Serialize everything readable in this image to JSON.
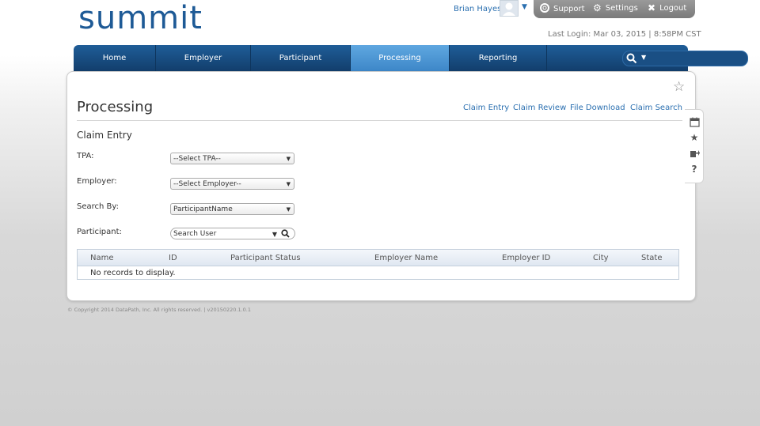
{
  "header": {
    "logo_text": "summit",
    "user_name": "Brian Hayes",
    "support_label": "Support",
    "settings_label": "Settings",
    "logout_label": "Logout",
    "last_login": "Last Login: Mar 03, 2015 | 8:58PM CST"
  },
  "nav": {
    "items": [
      {
        "label": "Home"
      },
      {
        "label": "Employer"
      },
      {
        "label": "Participant"
      },
      {
        "label": "Processing",
        "active": true
      },
      {
        "label": "Reporting"
      }
    ],
    "search_value": ""
  },
  "page": {
    "title": "Processing",
    "sublinks": [
      "Claim Entry",
      "Claim Review",
      "File Download",
      "Claim Search"
    ],
    "section_title": "Claim Entry"
  },
  "form": {
    "tpa_label": "TPA:",
    "tpa_value": "--Select TPA--",
    "employer_label": "Employer:",
    "employer_value": "--Select Employer--",
    "searchby_label": "Search By:",
    "searchby_value": "ParticipantName",
    "participant_label": "Participant:",
    "participant_placeholder": "Search User"
  },
  "grid": {
    "columns": [
      "Name",
      "ID",
      "Participant Status",
      "Employer Name",
      "Employer ID",
      "City",
      "State"
    ],
    "empty_message": "No records to display."
  },
  "footer": {
    "copyright": "© Copyright 2014 DataPath, Inc. All rights reserved. | v20150220.1.0.1"
  },
  "icons": {
    "user_menu": "chevron-down-icon",
    "support": "life-ring-icon",
    "settings": "gear-icon",
    "logout": "close-icon",
    "nav_search": "search-icon",
    "favorite": "star-outline-icon",
    "side_tools": [
      "calendar-icon",
      "star-icon",
      "export-icon",
      "help-icon"
    ]
  },
  "colors": {
    "brand": "#1e5a96",
    "nav_bg": "#1a4f84",
    "nav_active": "#4e98d6",
    "link": "#2a6fb0"
  }
}
